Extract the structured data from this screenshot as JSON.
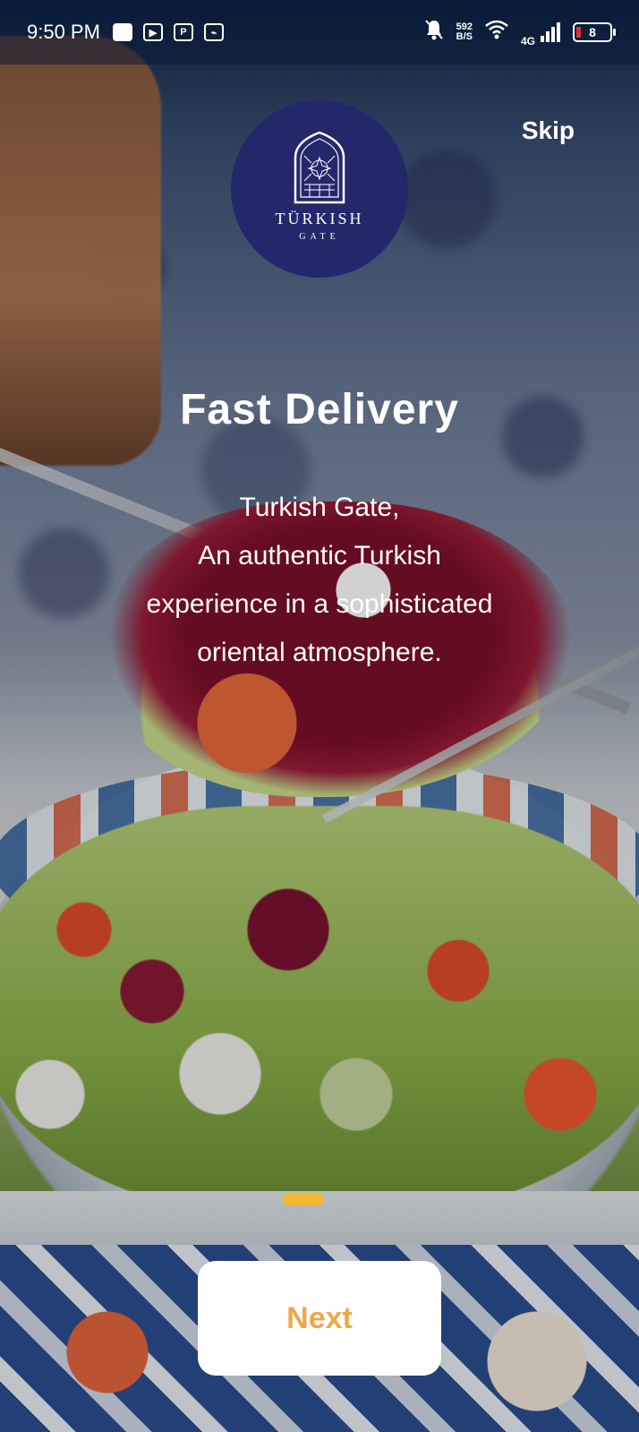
{
  "status_bar": {
    "time": "9:50 PM",
    "net_speed_value": "592",
    "net_speed_unit": "B/S",
    "network_type": "4G",
    "battery_level": "8"
  },
  "logo": {
    "brand": "TÜRKISH",
    "sub": "GATE"
  },
  "skip_label": "Skip",
  "onboarding": {
    "title": "Fast Delivery",
    "description_lines": [
      "Turkish Gate,",
      "An authentic Turkish",
      "experience in a sophisticated",
      "oriental atmosphere."
    ],
    "page_count": 1,
    "active_page": 1
  },
  "next_label": "Next",
  "colors": {
    "logo_bg": "#23286b",
    "pager_active": "#f1b832",
    "next_text": "#eea84a"
  }
}
